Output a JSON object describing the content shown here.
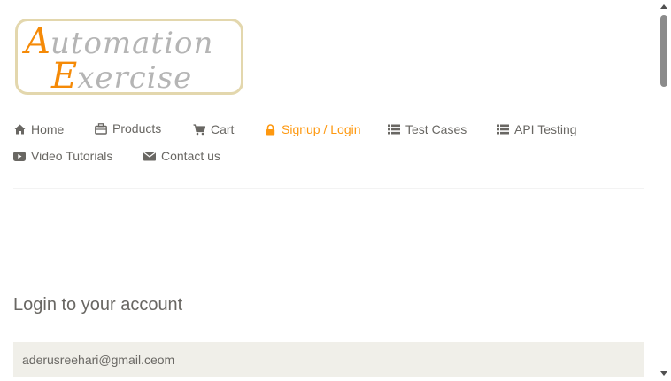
{
  "logo": {
    "line1_cap": "A",
    "line1_rest": "utomation",
    "line2_cap": "E",
    "line2_rest": "xercise"
  },
  "nav": {
    "items": [
      {
        "label": "Home",
        "icon": "home-icon"
      },
      {
        "label": "Products",
        "icon": "briefcase-icon"
      },
      {
        "label": "Cart",
        "icon": "cart-icon"
      },
      {
        "label": "Signup / Login",
        "icon": "lock-icon",
        "active": true
      },
      {
        "label": "Test Cases",
        "icon": "list-icon"
      },
      {
        "label": "API Testing",
        "icon": "list-icon"
      },
      {
        "label": "Video Tutorials",
        "icon": "youtube-play-icon"
      },
      {
        "label": "Contact us",
        "icon": "envelope-icon"
      }
    ]
  },
  "login": {
    "title": "Login to your account",
    "email_value": "aderusreehari@gmail.ceom"
  },
  "colors": {
    "accent": "#fe980f",
    "text": "#696763",
    "input_bg": "#f0efe9"
  }
}
